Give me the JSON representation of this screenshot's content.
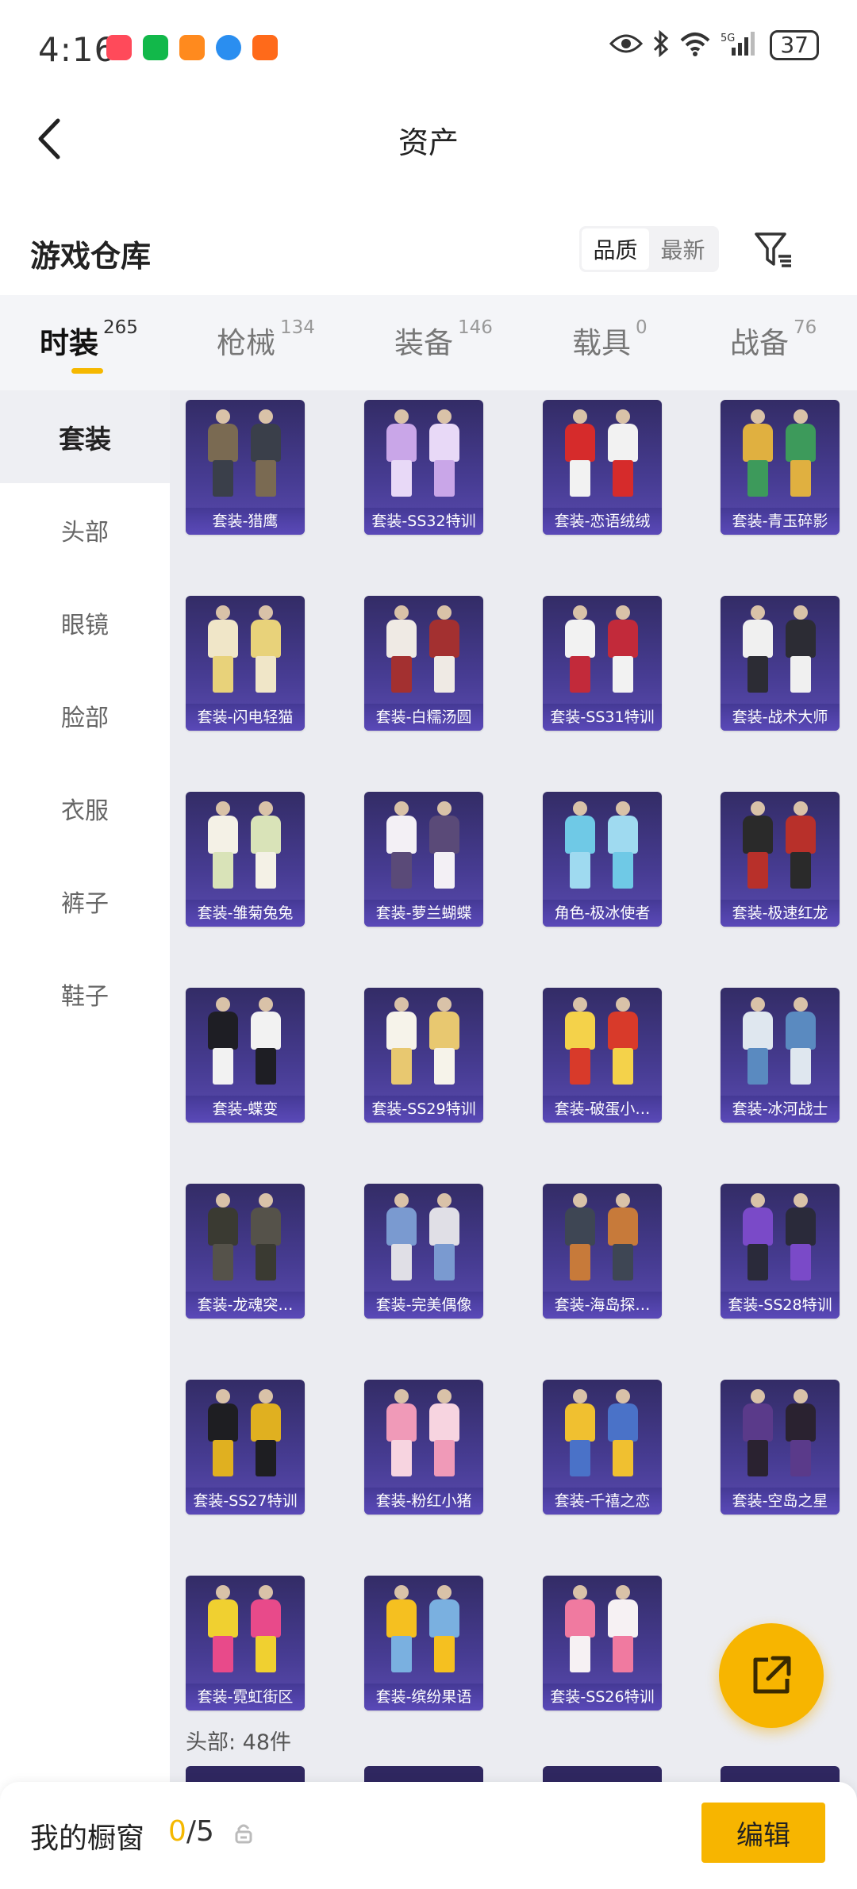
{
  "status": {
    "time": "4:16",
    "battery": "37"
  },
  "nav": {
    "title": "资产"
  },
  "section": {
    "title": "游戏仓库"
  },
  "sort": {
    "options": [
      "品质",
      "最新"
    ],
    "active": "品质"
  },
  "tabs": [
    {
      "label": "时装",
      "count": "265",
      "active": true
    },
    {
      "label": "枪械",
      "count": "134",
      "active": false
    },
    {
      "label": "装备",
      "count": "146",
      "active": false
    },
    {
      "label": "载具",
      "count": "0",
      "active": false
    },
    {
      "label": "战备",
      "count": "76",
      "active": false
    }
  ],
  "sidebar": [
    "套装",
    "头部",
    "眼镜",
    "脸部",
    "衣服",
    "裤子",
    "鞋子"
  ],
  "items": [
    {
      "label": "套装-猎鹰",
      "c1": "#7a6a52",
      "c2": "#3a3f4a"
    },
    {
      "label": "套装-SS32特训",
      "c1": "#c9a6e8",
      "c2": "#e8d9f7"
    },
    {
      "label": "套装-恋语绒绒",
      "c1": "#d62b2b",
      "c2": "#f2f2f2"
    },
    {
      "label": "套装-青玉碎影",
      "c1": "#e0b040",
      "c2": "#3d9a5b"
    },
    {
      "label": "套装-闪电轻猫",
      "c1": "#f0e6c8",
      "c2": "#e8d27a"
    },
    {
      "label": "套装-白糯汤圆",
      "c1": "#efeae4",
      "c2": "#a33030"
    },
    {
      "label": "套装-SS31特训",
      "c1": "#f2f2f2",
      "c2": "#c22a3a"
    },
    {
      "label": "套装-战术大师",
      "c1": "#f0f0f0",
      "c2": "#2c2c34"
    },
    {
      "label": "套装-雏菊兔兔",
      "c1": "#f4f1e6",
      "c2": "#d9e3b8"
    },
    {
      "label": "套装-萝兰蝴蝶",
      "c1": "#f3f0f5",
      "c2": "#5a4a78"
    },
    {
      "label": "角色-极冰使者",
      "c1": "#6fc9e6",
      "c2": "#9fdaf0"
    },
    {
      "label": "套装-极速红龙",
      "c1": "#2a2a2a",
      "c2": "#b8302a"
    },
    {
      "label": "套装-蝶变",
      "c1": "#1e1e24",
      "c2": "#f2f2f2"
    },
    {
      "label": "套装-SS29特训",
      "c1": "#f6f3ea",
      "c2": "#e8c870"
    },
    {
      "label": "套装-破蛋小…",
      "c1": "#f4d24a",
      "c2": "#d83a2a"
    },
    {
      "label": "套装-冰河战士",
      "c1": "#dfe7ef",
      "c2": "#5a8ac0"
    },
    {
      "label": "套装-龙魂突…",
      "c1": "#3a3a32",
      "c2": "#55524a"
    },
    {
      "label": "套装-完美偶像",
      "c1": "#7a9ad0",
      "c2": "#e0dfe6"
    },
    {
      "label": "套装-海岛探…",
      "c1": "#3e4654",
      "c2": "#c77a3a"
    },
    {
      "label": "套装-SS28特训",
      "c1": "#7a4ac8",
      "c2": "#2a2a3a"
    },
    {
      "label": "套装-SS27特训",
      "c1": "#1e1e22",
      "c2": "#e0b020"
    },
    {
      "label": "套装-粉红小猪",
      "c1": "#f09ab8",
      "c2": "#f7d4e0"
    },
    {
      "label": "套装-千禧之恋",
      "c1": "#f0c030",
      "c2": "#4a72c8"
    },
    {
      "label": "套装-空岛之星",
      "c1": "#5a3a8a",
      "c2": "#2a2230"
    },
    {
      "label": "套装-霓虹街区",
      "c1": "#f0d030",
      "c2": "#e84a8a"
    },
    {
      "label": "套装-缤纷果语",
      "c1": "#f5c020",
      "c2": "#7ab0e0"
    },
    {
      "label": "套装-SS26特训",
      "c1": "#f07aa0",
      "c2": "#f6f1f3"
    }
  ],
  "group_next": "头部: 48件",
  "bottom": {
    "label": "我的橱窗",
    "current": "0",
    "total": "/5",
    "edit": "编辑"
  }
}
